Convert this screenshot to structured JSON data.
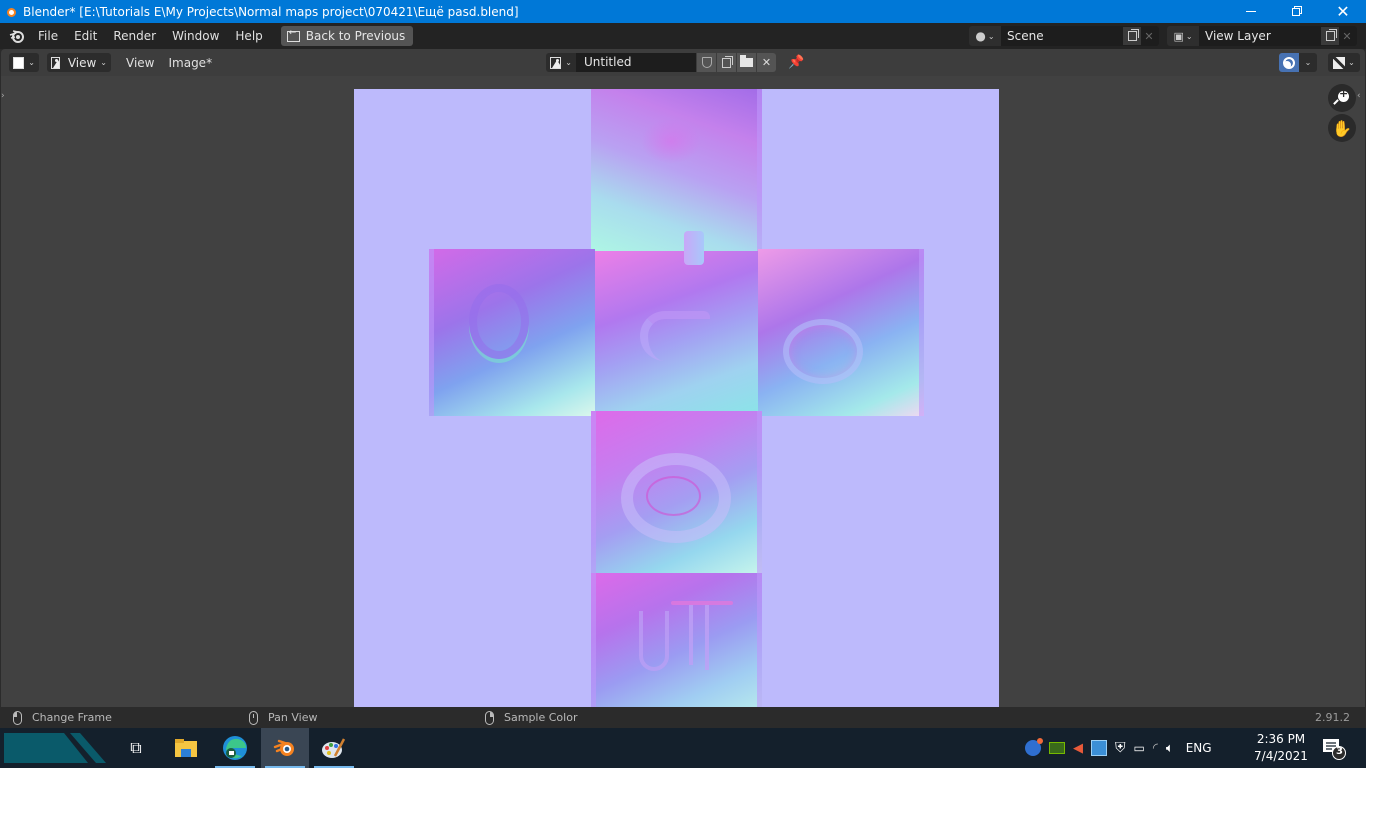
{
  "window": {
    "title": "Blender* [E:\\Tutorials E\\My Projects\\Normal maps project\\070421\\Ещё раsd.blend]",
    "app_icon": "blender-icon",
    "controls": [
      "minimize-icon",
      "restore-icon",
      "close-icon"
    ]
  },
  "topbar": {
    "menus": [
      "File",
      "Edit",
      "Render",
      "Window",
      "Help"
    ],
    "back_button": "Back to Previous",
    "scene": {
      "label": "Scene",
      "icon": "scene-icon"
    },
    "view_layer": {
      "label": "View Layer",
      "icon": "view-layer-icon"
    }
  },
  "editor_header": {
    "editor_type_icon": "image-editor-icon",
    "mode": "View",
    "menus": [
      "View",
      "Image*"
    ],
    "image_name": "Untitled",
    "image_buttons": [
      "fake-user-shield-icon",
      "new-image-copy-icon",
      "open-folder-icon",
      "unlink-close-icon"
    ],
    "pin_icon": "pin-icon",
    "overlay_icon": "overlay-icon",
    "display_icon": "display-channels-icon"
  },
  "viewport": {
    "gizmos": [
      "zoom-icon",
      "pan-hand-icon"
    ],
    "image_content": "normal-map-uv-cross-layout",
    "tiles": [
      "top",
      "left",
      "middle",
      "right",
      "bottom-1",
      "bottom-2"
    ],
    "colors": {
      "background": "#bdbafc",
      "editor_bg": "#414141"
    }
  },
  "statusbar": {
    "items": [
      {
        "icon": "mouse-left-icon",
        "label": "Change Frame"
      },
      {
        "icon": "mouse-middle-icon",
        "label": "Pan View"
      },
      {
        "icon": "mouse-right-icon",
        "label": "Sample Color"
      }
    ],
    "version": "2.91.2"
  },
  "taskbar": {
    "apps": [
      "task-view-icon",
      "file-explorer-icon",
      "edge-icon",
      "blender-icon",
      "paint-icon"
    ],
    "tray": {
      "icons": [
        "rocket-icon",
        "nvidia-icon",
        "volume-muted-icon",
        "intel-icon",
        "security-icon",
        "battery-icon",
        "wifi-icon",
        "speaker-icon"
      ],
      "language": "ENG",
      "time": "2:36 PM",
      "date": "7/4/2021",
      "notification_count": "3"
    }
  }
}
